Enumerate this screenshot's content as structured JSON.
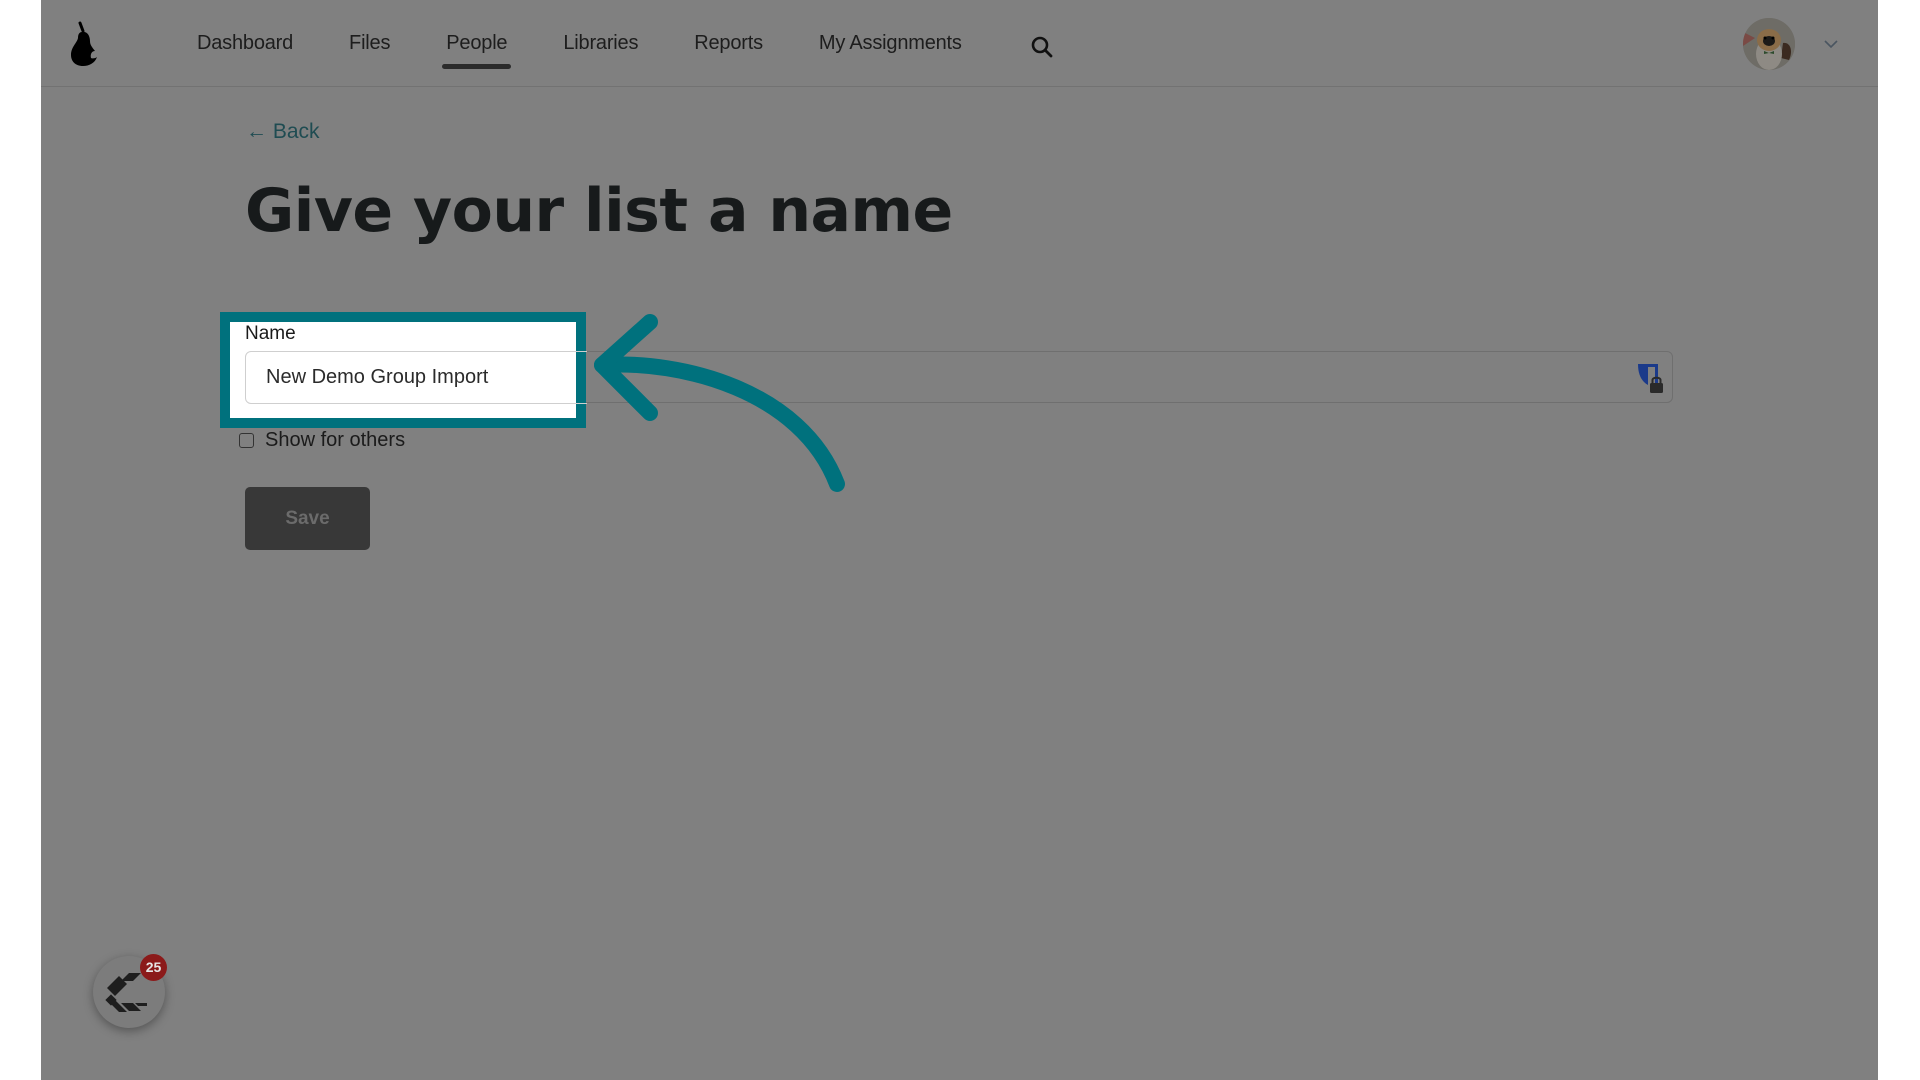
{
  "header": {
    "logo": "pear-logo-icon",
    "nav": [
      {
        "label": "Dashboard",
        "active": false
      },
      {
        "label": "Files",
        "active": false
      },
      {
        "label": "People",
        "active": true
      },
      {
        "label": "Libraries",
        "active": false
      },
      {
        "label": "Reports",
        "active": false
      },
      {
        "label": "My Assignments",
        "active": false
      }
    ],
    "search_icon": "search-icon",
    "avatar_icon": "user-avatar-photo",
    "menu_icon": "chevron-down-icon"
  },
  "page": {
    "back_label": "← Back",
    "title": "Give your list a name"
  },
  "form": {
    "name_label": "Name",
    "name_value": "New Demo Group Import",
    "password_manager_icon": "shield-lock-icon",
    "show_for_others_label": "Show for others",
    "show_for_others_checked": false,
    "save_label": "Save"
  },
  "annotation": {
    "color": "#00717d",
    "type": "highlight-box-with-curved-arrow"
  },
  "widget": {
    "icon": "chat-launcher-icon",
    "badge_count": "25"
  },
  "colors": {
    "overlay_bg": "#808080",
    "accent_teal": "#00717d",
    "badge_red": "#8b1a1a"
  }
}
